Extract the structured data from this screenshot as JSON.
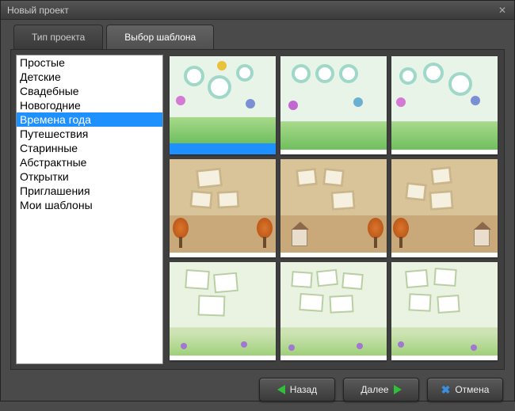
{
  "window": {
    "title": "Новый проект"
  },
  "tabs": [
    {
      "label": "Тип проекта",
      "active": false
    },
    {
      "label": "Выбор шаблона",
      "active": true
    }
  ],
  "categories": [
    "Простые",
    "Детские",
    "Свадебные",
    "Новогодние",
    "Времена года",
    "Путешествия",
    "Старинные",
    "Абстрактные",
    "Открытки",
    "Приглашения",
    "Мои шаблоны"
  ],
  "selected_category_index": 4,
  "templates": {
    "count": 9,
    "selected_index": 0,
    "rows": [
      {
        "style": "spring"
      },
      {
        "style": "autumn"
      },
      {
        "style": "green"
      }
    ]
  },
  "buttons": {
    "back": "Назад",
    "next": "Далее",
    "cancel": "Отмена"
  }
}
